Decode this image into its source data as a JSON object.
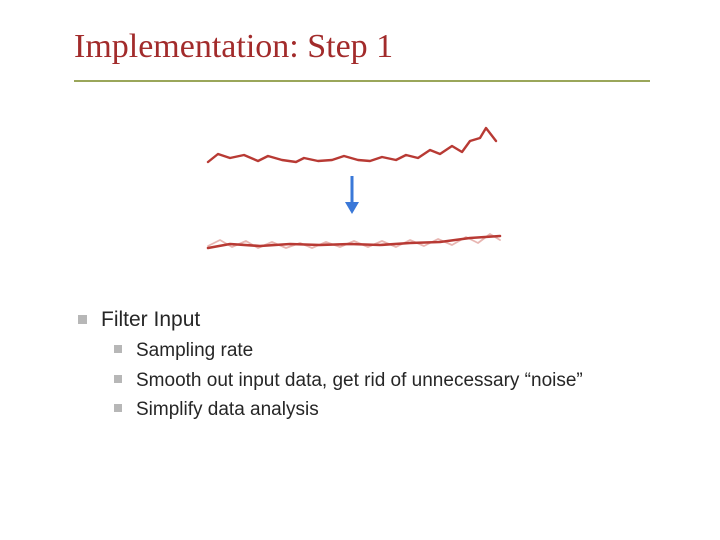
{
  "title": "Implementation: Step 1",
  "bullets": {
    "main": "Filter Input",
    "sub": [
      "Sampling rate",
      "Smooth out input data, get rid of unnecessary “noise”",
      "Simplify data analysis"
    ]
  },
  "colors": {
    "title": "#a22b2b",
    "rule": "#9aa65a",
    "signal": "#b83a34",
    "signal_faded": "#e8b6b2",
    "arrow": "#3a78d8",
    "bullet": "#b7b7b7"
  }
}
